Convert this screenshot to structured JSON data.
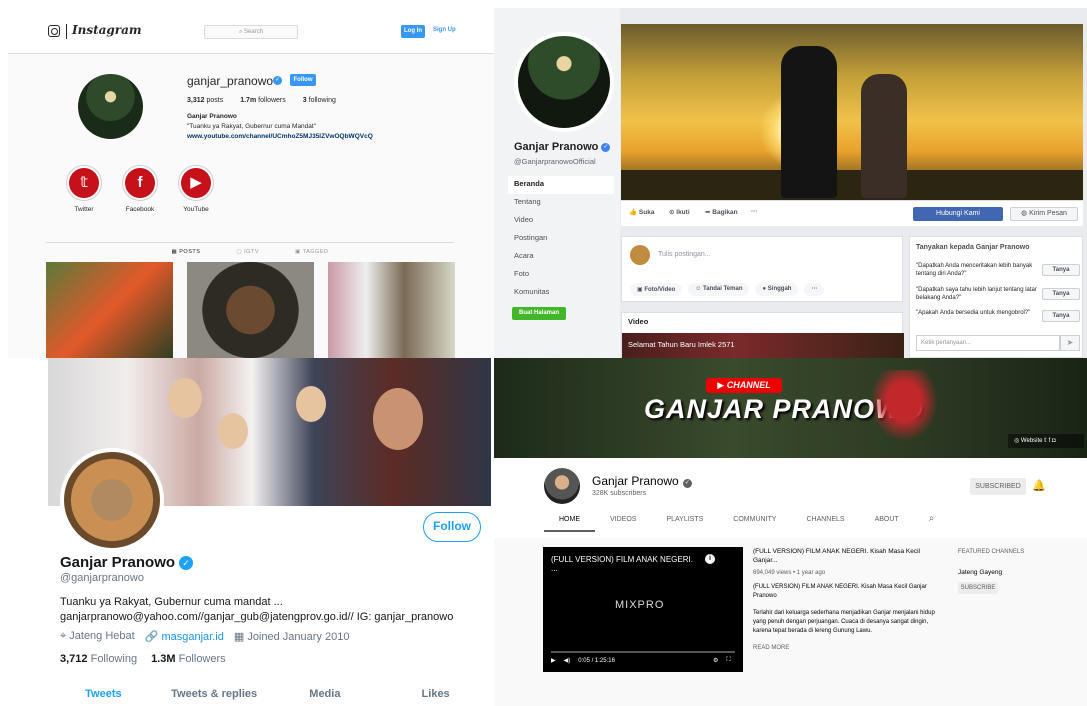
{
  "instagram": {
    "brand": "Instagram",
    "search_placeholder": "Search",
    "login": "Log In",
    "signup": "Sign Up",
    "username": "ganjar_pranowo",
    "follow": "Follow",
    "posts": "3,312",
    "posts_label": "posts",
    "followers": "1.7m",
    "followers_label": "followers",
    "following": "3",
    "following_label": "following",
    "full_name": "Ganjar Pranowo",
    "bio": "\"Tuanku ya Rakyat, Gubernur cuma Mandat\"",
    "link": "www.youtube.com/channel/UCmhoZ5MJ35lZVwOQbWQVcQ",
    "highlights": [
      "Twitter",
      "Facebook",
      "YouTube"
    ],
    "tabs": [
      "POSTS",
      "IGTV",
      "TAGGED"
    ]
  },
  "facebook": {
    "name": "Ganjar Pranowo",
    "handle": "@GanjarpranowoOfficial",
    "nav": [
      "Beranda",
      "Tentang",
      "Video",
      "Postingan",
      "Acara",
      "Foto",
      "Komunitas"
    ],
    "create_page": "Buat Halaman",
    "actions": [
      "Suka",
      "Ikuti",
      "Bagikan",
      "···"
    ],
    "contact": "Hubungi Kami",
    "send_message": "Kirim Pesan",
    "composer_placeholder": "Tulis postingan...",
    "composer_buttons": [
      "Foto/Video",
      "Tandai Teman",
      "Singgah",
      "···"
    ],
    "video_heading": "Video",
    "video_title": "Selamat Tahun Baru Imlek 2571",
    "ask_heading": "Tanyakan kepada Ganjar Pranowo",
    "questions": [
      "\"Dapatkah Anda menceritakan lebih banyak tentang diri Anda?\"",
      "\"Dapatkah saya tahu lebih lanjut tentang latar belakang Anda?\"",
      "\"Apakah Anda bersedia untuk mengobrol?\""
    ],
    "ask_button": "Tanya",
    "ask_placeholder": "Ketik pertanyaan..."
  },
  "twitter": {
    "follow": "Follow",
    "name": "Ganjar Pranowo",
    "handle": "@ganjarpranowo",
    "bio_line1": "Tuanku ya Rakyat, Gubernur cuma mandat ...",
    "bio_line2": "ganjarpranowo@yahoo.com//ganjar_gub@jatengprov.go.id// IG: ganjar_pranowo",
    "location": "Jateng Hebat",
    "website": "masganjar.id",
    "joined": "Joined January 2010",
    "following_count": "3,712",
    "following_label": "Following",
    "followers_count": "1.3M",
    "followers_label": "Followers",
    "tabs": [
      "Tweets",
      "Tweets & replies",
      "Media",
      "Likes"
    ]
  },
  "youtube": {
    "badge": "CHANNEL",
    "banner_title": "GANJAR PRANOWO",
    "banner_links": "Website",
    "name": "Ganjar Pranowo",
    "subscribers": "328K subscribers",
    "subscribed": "SUBSCRIBED",
    "tabs": [
      "HOME",
      "VIDEOS",
      "PLAYLISTS",
      "COMMUNITY",
      "CHANNELS",
      "ABOUT"
    ],
    "player_title": "(FULL VERSION) FILM ANAK NEGERI. ...",
    "player_logo": "MIXPRO",
    "player_time": "0:05 / 1:25:16",
    "video_title": "(FULL VERSION) FILM ANAK NEGERI. Kisah Masa Kecil Ganjar...",
    "video_meta": "694,049 views • 1 year ago",
    "video_desc_title": "(FULL VERSION) FILM ANAK NEGERI. Kisah Masa Kecil Ganjar Pranowo",
    "video_desc": "Terlahir dari keluarga sederhana menjadikan Ganjar menjalani hidup yang penuh dengan perjuangan. Cuaca di desanya sangat dingin, karena tepat berada di lereng Gunung Lawu.",
    "read_more": "READ MORE",
    "featured_heading": "FEATURED CHANNELS",
    "featured_channel": "Jateng Gayeng",
    "featured_subscribe": "SUBSCRIBE"
  }
}
